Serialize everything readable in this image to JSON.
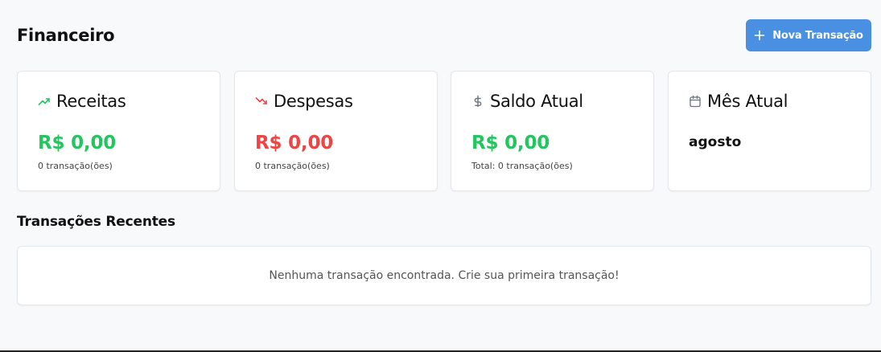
{
  "header": {
    "title": "Financeiro",
    "new_button_label": "Nova Transação",
    "new_button_icon": "plus-icon"
  },
  "cards": [
    {
      "icon": "trending-up-icon",
      "title": "Receitas",
      "amount": "R$ 0,00",
      "subtitle": "0 transação(ões)",
      "color": "#22c55e"
    },
    {
      "icon": "trending-down-icon",
      "title": "Despesas",
      "amount": "R$ 0,00",
      "subtitle": "0 transação(ões)",
      "color": "#ef4444"
    },
    {
      "icon": "dollar-icon",
      "title": "Saldo Atual",
      "amount": "R$ 0,00",
      "subtitle": "Total: 0 transação(ões)",
      "color": "#22c55e"
    },
    {
      "icon": "calendar-icon",
      "title": "Mês Atual",
      "value": "agosto"
    }
  ],
  "recent": {
    "title": "Transações Recentes",
    "empty_message": "Nenhuma transação encontrada. Crie sua primeira transação!"
  },
  "colors": {
    "accent": "#4a90e2",
    "positive": "#22c55e",
    "negative": "#ef4444",
    "background": "#f8f9fb"
  }
}
